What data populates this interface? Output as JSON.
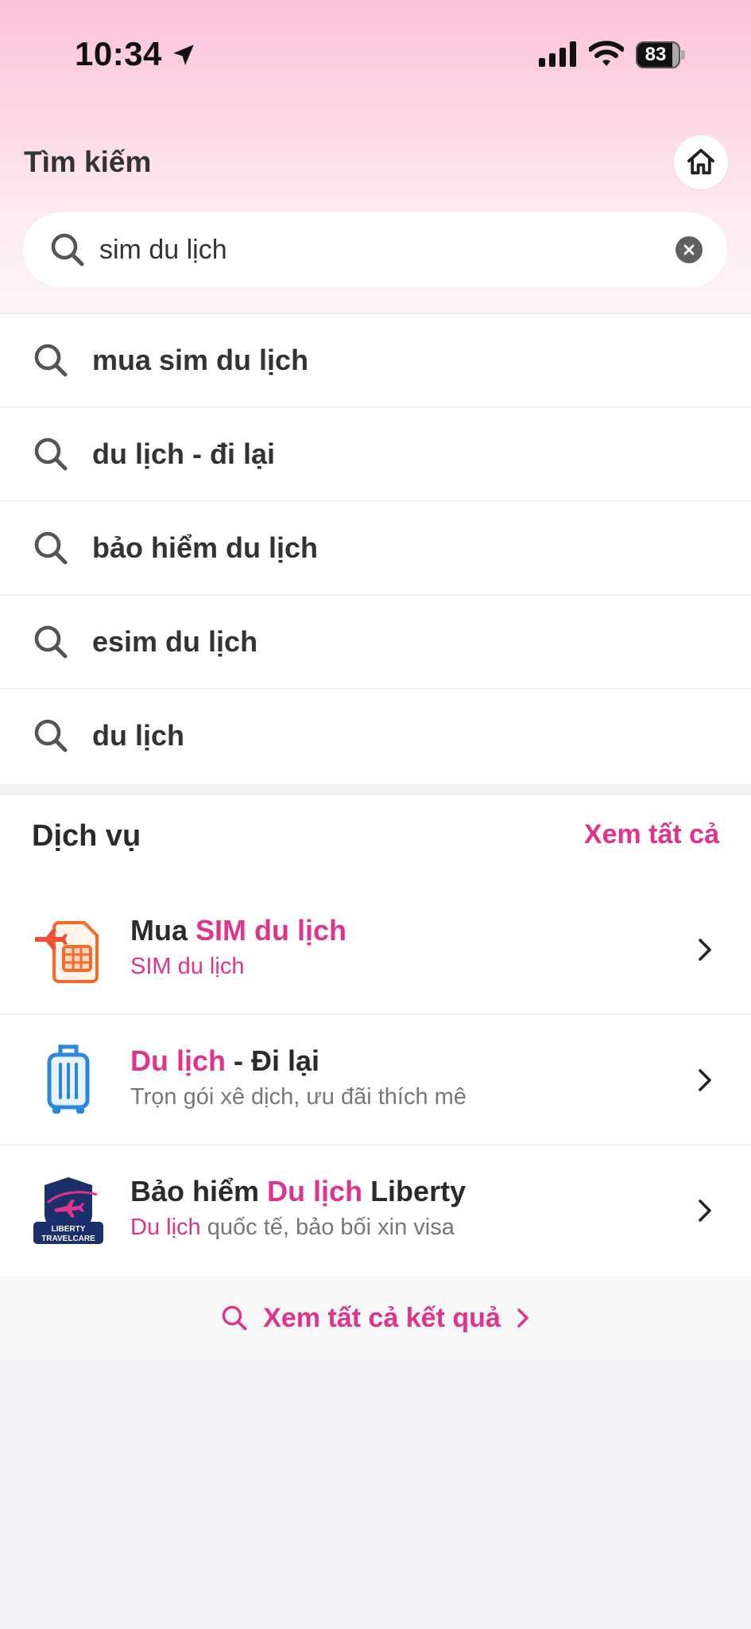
{
  "status_bar": {
    "time": "10:34",
    "battery": "83"
  },
  "header": {
    "title": "Tìm kiếm"
  },
  "search": {
    "value": "sim du lịch"
  },
  "suggestions": [
    {
      "label": "mua sim du lịch"
    },
    {
      "label": "du lịch - đi lại"
    },
    {
      "label": "bảo hiểm du lịch"
    },
    {
      "label": "esim du lịch"
    },
    {
      "label": "du lịch"
    }
  ],
  "services": {
    "title": "Dịch vụ",
    "see_all": "Xem tất cả",
    "items": [
      {
        "name_parts": [
          "Mua ",
          "SIM du lịch"
        ],
        "sub_parts": [
          "SIM du lịch"
        ],
        "icon": "plane-sim-icon"
      },
      {
        "name_parts": [
          "Du lịch",
          " - Đi lại"
        ],
        "sub_parts": [
          "Trọn gói xê dịch, ưu đãi thích mê"
        ],
        "icon": "suitcase-icon"
      },
      {
        "name_parts": [
          "Bảo hiểm ",
          "Du lịch",
          " Liberty"
        ],
        "sub_parts": [
          "Du lịch",
          " quốc tế, bảo bối xin visa"
        ],
        "icon": "liberty-travelcare-logo",
        "logo_text": [
          "LIBERTY",
          "TRAVELCARE"
        ]
      }
    ]
  },
  "footer": {
    "all_results": "Xem tất cả kết quả"
  },
  "colors": {
    "accent": "#e0338c",
    "header_gradient_top": "#fbc3d9",
    "background": "#f2f2f6"
  }
}
